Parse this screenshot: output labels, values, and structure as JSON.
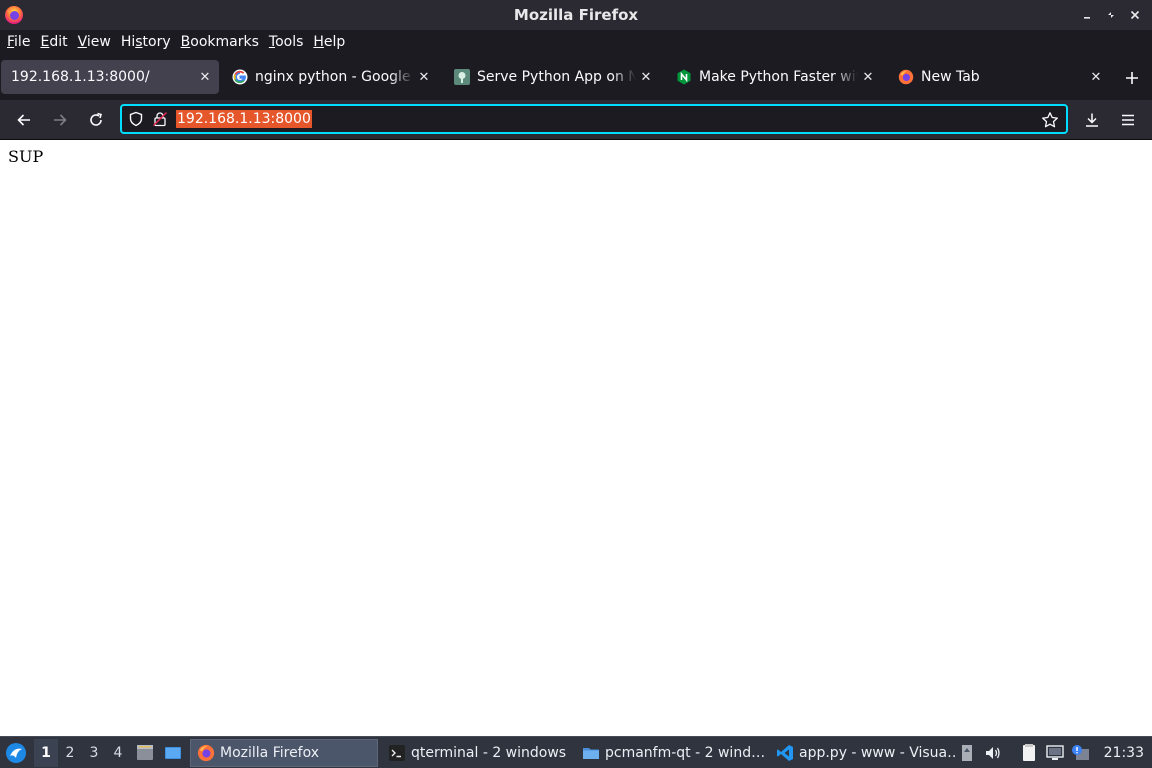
{
  "window": {
    "title": "Mozilla Firefox",
    "minimize_icon": "minimize-icon",
    "maximize_icon": "maximize-icon",
    "close_icon": "close-icon"
  },
  "menubar": {
    "items": [
      {
        "label": "File",
        "accel": "F",
        "rest": "ile"
      },
      {
        "label": "Edit",
        "accel": "E",
        "rest": "dit"
      },
      {
        "label": "View",
        "accel": "V",
        "rest": "iew"
      },
      {
        "label": "History",
        "pre": "Hi",
        "accel": "s",
        "rest": "tory"
      },
      {
        "label": "Bookmarks",
        "accel": "B",
        "rest": "ookmarks"
      },
      {
        "label": "Tools",
        "accel": "T",
        "rest": "ools"
      },
      {
        "label": "Help",
        "accel": "H",
        "rest": "elp"
      }
    ]
  },
  "tabs": [
    {
      "label": "192.168.1.13:8000/",
      "active": true,
      "favicon": "none"
    },
    {
      "label": "nginx python - Google Search",
      "active": false,
      "favicon": "google-icon"
    },
    {
      "label": "Serve Python App on Nginx",
      "active": false,
      "favicon": "site-icon"
    },
    {
      "label": "Make Python Faster with",
      "active": false,
      "favicon": "nginx-icon"
    },
    {
      "label": "New Tab",
      "active": false,
      "favicon": "firefox-icon"
    }
  ],
  "navbar": {
    "url": "192.168.1.13:8000",
    "selection_color": "#e5562a",
    "focus_ring_color": "#00ddff"
  },
  "page": {
    "body_text": "SUP"
  },
  "taskbar": {
    "workspaces": [
      "1",
      "2",
      "3",
      "4"
    ],
    "current_workspace": "1",
    "tasks": [
      {
        "label": "Mozilla Firefox",
        "icon": "firefox-icon",
        "active": true
      },
      {
        "label": "qterminal - 2 windows",
        "icon": "terminal-icon",
        "active": false
      },
      {
        "label": "pcmanfm-qt - 2 wind…",
        "icon": "folder-icon",
        "active": false
      },
      {
        "label": "app.py - www - Visua…",
        "icon": "vscode-icon",
        "active": false
      }
    ],
    "clock": "21:33"
  },
  "colors": {
    "titlebar_bg": "#2b2a33",
    "tabstrip_bg": "#1c1b22",
    "active_tab_bg": "#42414d",
    "taskbar_bg": "#2f343f"
  }
}
